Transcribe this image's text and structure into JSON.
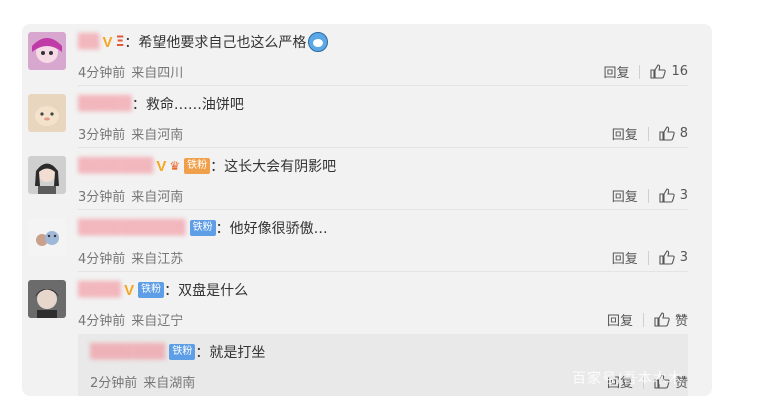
{
  "comments": [
    {
      "username": "▒▒",
      "comment": "：希望他要求自己也这么严格",
      "time": "4分钟前",
      "location": "来自四川",
      "reply_label": "回复",
      "like_count": "16"
    },
    {
      "username": "▒▒▒▒▒",
      "comment": "：救命……油饼吧",
      "time": "3分钟前",
      "location": "来自河南",
      "reply_label": "回复",
      "like_count": "8"
    },
    {
      "username": "▒▒▒▒▒▒▒",
      "badge": "铁粉",
      "comment": "：这长大会有阴影吧",
      "time": "3分钟前",
      "location": "来自河南",
      "reply_label": "回复",
      "like_count": "3"
    },
    {
      "username": "▒▒▒▒▒▒▒▒▒▒",
      "badge": "铁粉",
      "comment": "：他好像很骄傲…",
      "time": "4分钟前",
      "location": "来自江苏",
      "reply_label": "回复",
      "like_count": "3"
    },
    {
      "username": "▒▒▒▒",
      "badge": "铁粉",
      "comment": "：双盘是什么",
      "time": "4分钟前",
      "location": "来自辽宁",
      "reply_label": "回复",
      "like_count": "赞"
    }
  ],
  "reply": {
    "username": "▒▒▒▒▒▒▒",
    "badge": "铁粉",
    "comment": "：就是打坐",
    "time": "2分钟前",
    "location": "来自湖南",
    "reply_label": "回复",
    "like_count": "赞"
  },
  "watermark": "百家号/吾本木木",
  "colors": {
    "username": "#f27e8a",
    "badge_bg": "#5e9ee6",
    "vip": "#f5a623"
  }
}
